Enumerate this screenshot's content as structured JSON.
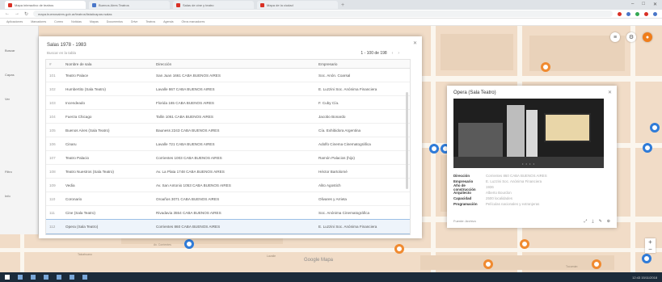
{
  "browser": {
    "tabs": [
      {
        "label": "Mapa interactivo de teatros"
      },
      {
        "label": "Buenos Aires Teatros"
      },
      {
        "label": "Salas de cine y teatro"
      },
      {
        "label": "Mapa de la ciudad"
      }
    ],
    "new_tab_symbol": "+",
    "window_controls": {
      "minimize": "–",
      "maximize": "□",
      "close": "✕"
    },
    "nav": {
      "back": "←",
      "forward": "→",
      "reload": "↻"
    },
    "url": "mapa.buenosaires.gob.ar/teatros/lista#capas=salas",
    "bookmarks": [
      "Aplicaciones",
      "Marcadores",
      "Correo",
      "Noticias",
      "Mapas",
      "Documentos",
      "Drive",
      "Teatros",
      "Agenda",
      "Otros marcadores"
    ]
  },
  "map": {
    "watermark": "Google  Mapa",
    "controls": {
      "list": "≡",
      "settings": "⚙",
      "user": "●"
    },
    "zoom": {
      "in": "+",
      "out": "−"
    },
    "street_labels": [
      "Av. Corrientes",
      "Talcahuano",
      "Lavalle",
      "Tucumán"
    ],
    "rail_items": [
      "Buscar",
      "Capas",
      "Ver",
      "Filtro",
      "Info"
    ],
    "accent_color": "#f07d1a",
    "marker_blue": "#2f7bd8"
  },
  "dialog": {
    "title": "Salas 1978 - 1983",
    "close": "✕",
    "search_placeholder": "Buscar en la tabla",
    "pager": {
      "range": "1 - 100 de 198",
      "prev": "‹",
      "next": "›"
    },
    "columns": {
      "num": "#",
      "name": "Nombre de sala",
      "dir": "Dirección",
      "emp": "Empresario"
    },
    "rows": [
      {
        "num": "101",
        "name": "Teatro Palace",
        "dir": "San Juan 1661 CABA BUENOS AIRES",
        "emp": "Soc. Anón. Coarsal"
      },
      {
        "num": "102",
        "name": "Humbertito (Sala Teatro)",
        "dir": "Lavalle 867 CABA BUENOS AIRES",
        "emp": "E. Luzzini Soc. Anónima Financiera"
      },
      {
        "num": "103",
        "name": "Incendeado",
        "dir": "Florida 165 CABA BUENOS AIRES",
        "emp": "F. Cuby Cía."
      },
      {
        "num": "104",
        "name": "Fuerza Chicago",
        "dir": "Tallin 1061 CABA BUENOS AIRES",
        "emp": "Jacobo Bonardo"
      },
      {
        "num": "105",
        "name": "Buenos Aires (Sala Teatro)",
        "dir": "Bauness 2243 CABA BUENOS AIRES",
        "emp": "Cía. Exhibidora Argentina"
      },
      {
        "num": "106",
        "name": "Cinaru",
        "dir": "Lavalle 721 CABA BUENOS AIRES",
        "emp": "Adolfo Cinema Cinematográfica"
      },
      {
        "num": "107",
        "name": "Teatro Palacio",
        "dir": "Corrientes 1003 CABA BUENOS AIRES",
        "emp": "Ramón Palacios (hijo)"
      },
      {
        "num": "108",
        "name": "Teatro Nuestros (Sala Teatro)",
        "dir": "Av. La Plata 1748 CABA BUENOS AIRES",
        "emp": "Héctor Bartolomé"
      },
      {
        "num": "109",
        "name": "Vedia",
        "dir": "Av. San Antonio 1053 CABA BUENOS AIRES",
        "emp": "Alito Agostich"
      },
      {
        "num": "110",
        "name": "Coronario",
        "dir": "Oroaños 3071 CABA BUENOS AIRES",
        "emp": "Olivares y Arrieta"
      },
      {
        "num": "111",
        "name": "Cine (Sala Teatro)",
        "dir": "Rivadavia 3554 CABA BUENOS AIRES",
        "emp": "Soc. Anónima Cinematográfica"
      },
      {
        "num": "112",
        "name": "Opera (Sala Teatro)",
        "dir": "Corrientes 860 CABA BUENOS AIRES",
        "emp": "E. Luzzini Soc. Anónima Financiera"
      }
    ]
  },
  "card": {
    "title": "Opera (Sala Teatro)",
    "close": "✕",
    "photo_dots": "• • • •",
    "fields": [
      {
        "label": "Dirección",
        "value": "Corrientes 860 CABA BUENOS AIRES"
      },
      {
        "label": "Empresario",
        "value": "E. Luzzini Soc. Anónima Financiera"
      },
      {
        "label": "Año de construcción",
        "value": "1936"
      },
      {
        "label": "Arquitecto",
        "value": "Alberto Bourdon"
      },
      {
        "label": "Capacidad",
        "value": "2500 localidades"
      },
      {
        "label": "Programación",
        "value": "Películas nacionales y extranjeras"
      }
    ],
    "footer_text": "Fuente: Archivo",
    "footer_icons": [
      "⤢",
      "⤓",
      "✎",
      "⊕"
    ]
  },
  "taskbar": {
    "tray_time": "12:43  15/11/2018"
  }
}
